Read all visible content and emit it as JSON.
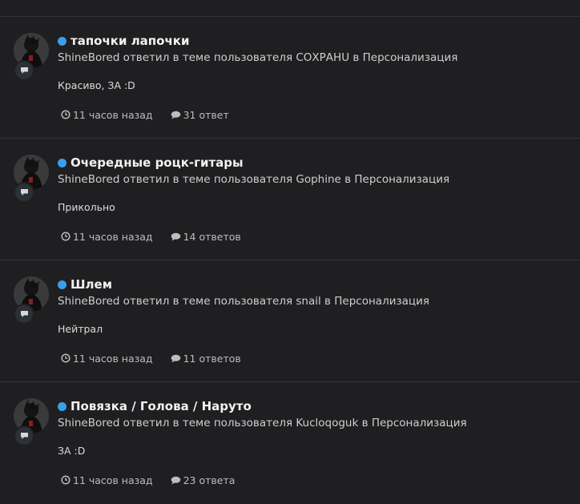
{
  "colors": {
    "background": "#1f1f21",
    "unread_dot": "#3b9fe8",
    "divider": "#343437"
  },
  "items": [
    {
      "title": "тапочки лапочки",
      "subtitle": "ShineBored ответил в теме пользователя СОХРАНU в Персонализация",
      "snippet": "Красиво, ЗА :D",
      "time": "11 часов назад",
      "replies": "31 ответ",
      "unread": true,
      "avatar_icon": "user-avatar",
      "badge_icon": "comment-icon"
    },
    {
      "title": "Очередные роцк-гитары",
      "subtitle": "ShineBored ответил в теме пользователя Gophine в Персонализация",
      "snippet": "Прикольно",
      "time": "11 часов назад",
      "replies": "14 ответов",
      "unread": true,
      "avatar_icon": "user-avatar",
      "badge_icon": "comment-icon"
    },
    {
      "title": "Шлем",
      "subtitle": "ShineBored ответил в теме пользователя snail в Персонализация",
      "snippet": "Нейтрал",
      "time": "11 часов назад",
      "replies": "11 ответов",
      "unread": true,
      "avatar_icon": "user-avatar",
      "badge_icon": "comment-icon"
    },
    {
      "title": "Повязка / Голова / Наруто",
      "subtitle": "ShineBored ответил в теме пользователя Kucloqoguk в Персонализация",
      "snippet": "ЗА :D",
      "time": "11 часов назад",
      "replies": "23 ответа",
      "unread": true,
      "avatar_icon": "user-avatar",
      "badge_icon": "comment-icon"
    }
  ]
}
